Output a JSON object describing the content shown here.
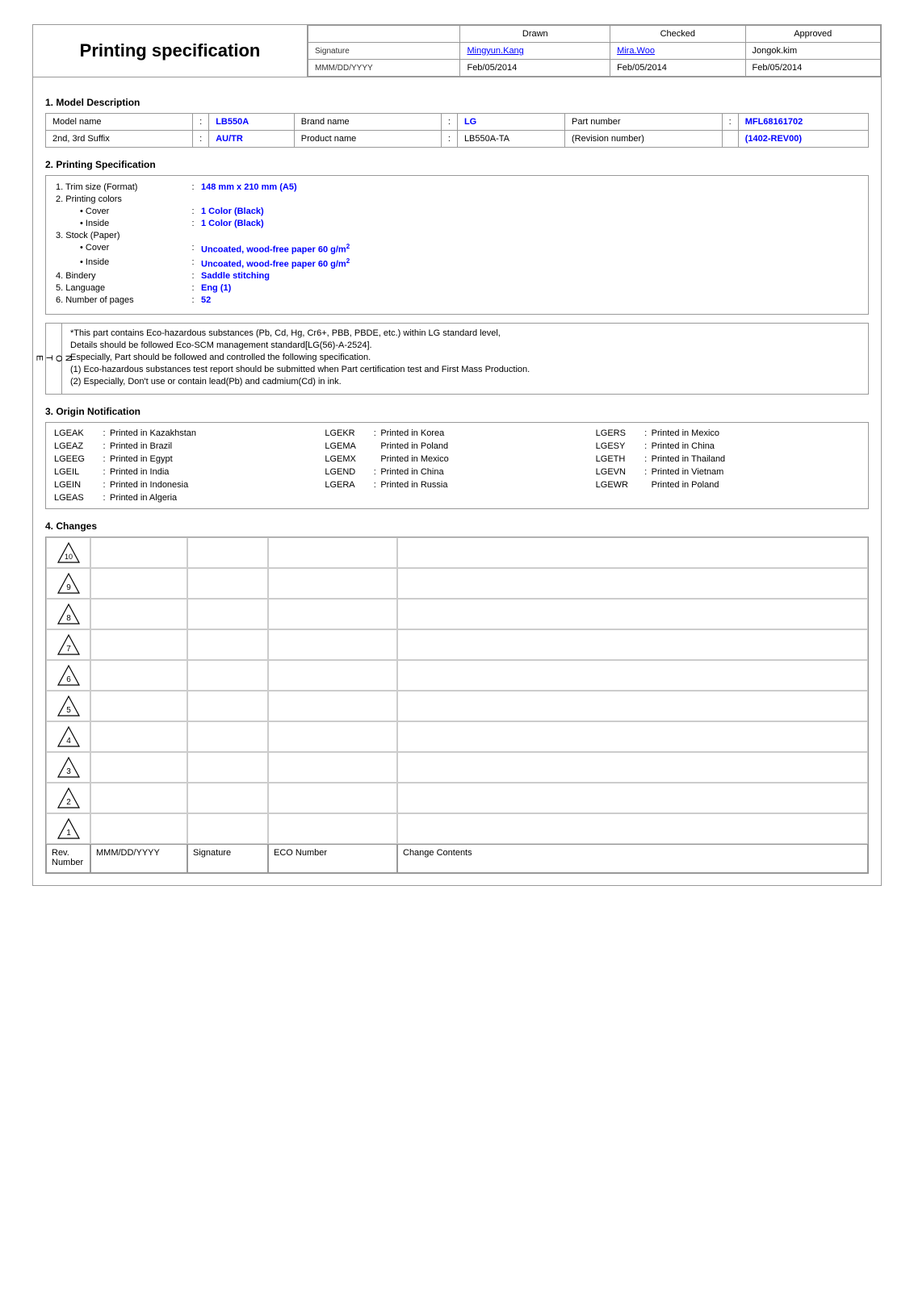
{
  "header": {
    "title": "Printing specification",
    "approval": {
      "columns": [
        "",
        "Drawn",
        "Checked",
        "Approved"
      ],
      "signature_label": "Signature",
      "date_label": "MMM/DD/YYYY",
      "drawn": {
        "name": "Mingyun.Kang",
        "date": "Feb/05/2014"
      },
      "checked": {
        "name": "Mira.Woo",
        "date": "Feb/05/2014"
      },
      "approved": {
        "name": "Jongok.kim",
        "date": "Feb/05/2014"
      }
    }
  },
  "section1": {
    "title": "1. Model Description",
    "rows": [
      {
        "label": "Model name",
        "colon": ":",
        "value": "LB550A",
        "label2": "Brand name",
        "colon2": ":",
        "value2": "LG",
        "label3": "Part number",
        "colon3": ":",
        "value3": "MFL68161702"
      },
      {
        "label": "2nd, 3rd Suffix",
        "colon": ":",
        "value": "AU/TR",
        "label2": "Product name",
        "colon2": ":",
        "value2": "LB550A-TA",
        "label3": "(Revision number)",
        "colon3": "",
        "value3": "(1402-REV00)"
      }
    ]
  },
  "section2": {
    "title": "2. Printing Specification",
    "items": [
      {
        "num": "1.",
        "label": "Trim size (Format)",
        "colon": ":",
        "value": "148 mm x 210 mm (A5)",
        "sub": []
      },
      {
        "num": "2.",
        "label": "Printing colors",
        "colon": "",
        "value": "",
        "sub": [
          {
            "bullet": "• Cover",
            "colon": ":",
            "value": "1 Color (Black)"
          },
          {
            "bullet": "• Inside",
            "colon": ":",
            "value": "1 Color (Black)"
          }
        ]
      },
      {
        "num": "3.",
        "label": "Stock (Paper)",
        "colon": "",
        "value": "",
        "sub": [
          {
            "bullet": "• Cover",
            "colon": ":",
            "value": "Uncoated, wood-free paper 60 g/m²"
          },
          {
            "bullet": "• Inside",
            "colon": ":",
            "value": "Uncoated, wood-free paper 60 g/m²"
          }
        ]
      },
      {
        "num": "4.",
        "label": "Bindery",
        "colon": ":",
        "value": "Saddle stitching",
        "sub": []
      },
      {
        "num": "5.",
        "label": "Language",
        "colon": ":",
        "value": "Eng (1)",
        "sub": []
      },
      {
        "num": "6.",
        "label": "Number of pages",
        "colon": ":",
        "value": "52",
        "sub": []
      }
    ]
  },
  "note": {
    "side_label": "NOTE",
    "lines": [
      "*This part contains Eco-hazardous substances (Pb, Cd, Hg, Cr6+, PBB, PBDE, etc.) within LG standard level,",
      "Details should be followed Eco-SCM management standard[LG(56)-A-2524].",
      "Especially, Part should be followed and controlled the following specification.",
      "(1) Eco-hazardous substances test report should be submitted when Part certification test and First Mass Production.",
      "(2) Especially, Don't use or contain lead(Pb) and cadmium(Cd) in ink."
    ]
  },
  "section3": {
    "title": "3. Origin Notification",
    "items": [
      {
        "code": "LGEAK",
        "colon": ":",
        "desc": "Printed in Kazakhstan"
      },
      {
        "code": "LGEKR",
        "colon": ":",
        "desc": "Printed in Korea"
      },
      {
        "code": "LGERS",
        "colon": ":",
        "desc": "Printed in Mexico"
      },
      {
        "code": "LGEAZ",
        "colon": ":",
        "desc": "Printed in Brazil"
      },
      {
        "code": "LGEMA",
        "colon": "",
        "desc": "Printed in Poland"
      },
      {
        "code": "LGESY",
        "colon": ":",
        "desc": "Printed in China"
      },
      {
        "code": "LGEEG",
        "colon": ":",
        "desc": "Printed in Egypt"
      },
      {
        "code": "LGEMX",
        "colon": "",
        "desc": "Printed in Mexico"
      },
      {
        "code": "LGETH",
        "colon": ":",
        "desc": "Printed in Thailand"
      },
      {
        "code": "LGEIL",
        "colon": ":",
        "desc": "Printed in India"
      },
      {
        "code": "LGEND",
        "colon": ":",
        "desc": "Printed in China"
      },
      {
        "code": "LGEVN",
        "colon": ":",
        "desc": "Printed in Vietnam"
      },
      {
        "code": "LGEIN",
        "colon": ":",
        "desc": "Printed in Indonesia"
      },
      {
        "code": "LGERA",
        "colon": ":",
        "desc": "Printed in Russia"
      },
      {
        "code": "LGEWR",
        "colon": "",
        "desc": "Printed in Poland"
      },
      {
        "code": "LGEAS",
        "colon": ":",
        "desc": "Printed in Algeria"
      },
      {
        "code": "",
        "colon": "",
        "desc": ""
      },
      {
        "code": "",
        "colon": "",
        "desc": ""
      }
    ]
  },
  "section4": {
    "title": "4. Changes",
    "rows": [
      {
        "rev": "10",
        "date": "",
        "sig": "",
        "eco": "",
        "content": ""
      },
      {
        "rev": "9",
        "date": "",
        "sig": "",
        "eco": "",
        "content": ""
      },
      {
        "rev": "8",
        "date": "",
        "sig": "",
        "eco": "",
        "content": ""
      },
      {
        "rev": "7",
        "date": "",
        "sig": "",
        "eco": "",
        "content": ""
      },
      {
        "rev": "6",
        "date": "",
        "sig": "",
        "eco": "",
        "content": ""
      },
      {
        "rev": "5",
        "date": "",
        "sig": "",
        "eco": "",
        "content": ""
      },
      {
        "rev": "4",
        "date": "",
        "sig": "",
        "eco": "",
        "content": ""
      },
      {
        "rev": "3",
        "date": "",
        "sig": "",
        "eco": "",
        "content": ""
      },
      {
        "rev": "2",
        "date": "",
        "sig": "",
        "eco": "",
        "content": ""
      },
      {
        "rev": "1",
        "date": "",
        "sig": "",
        "eco": "",
        "content": ""
      }
    ],
    "footer": {
      "col1": "Rev. Number",
      "col2": "MMM/DD/YYYY",
      "col3": "Signature",
      "col4": "ECO Number",
      "col5": "Change Contents"
    }
  }
}
